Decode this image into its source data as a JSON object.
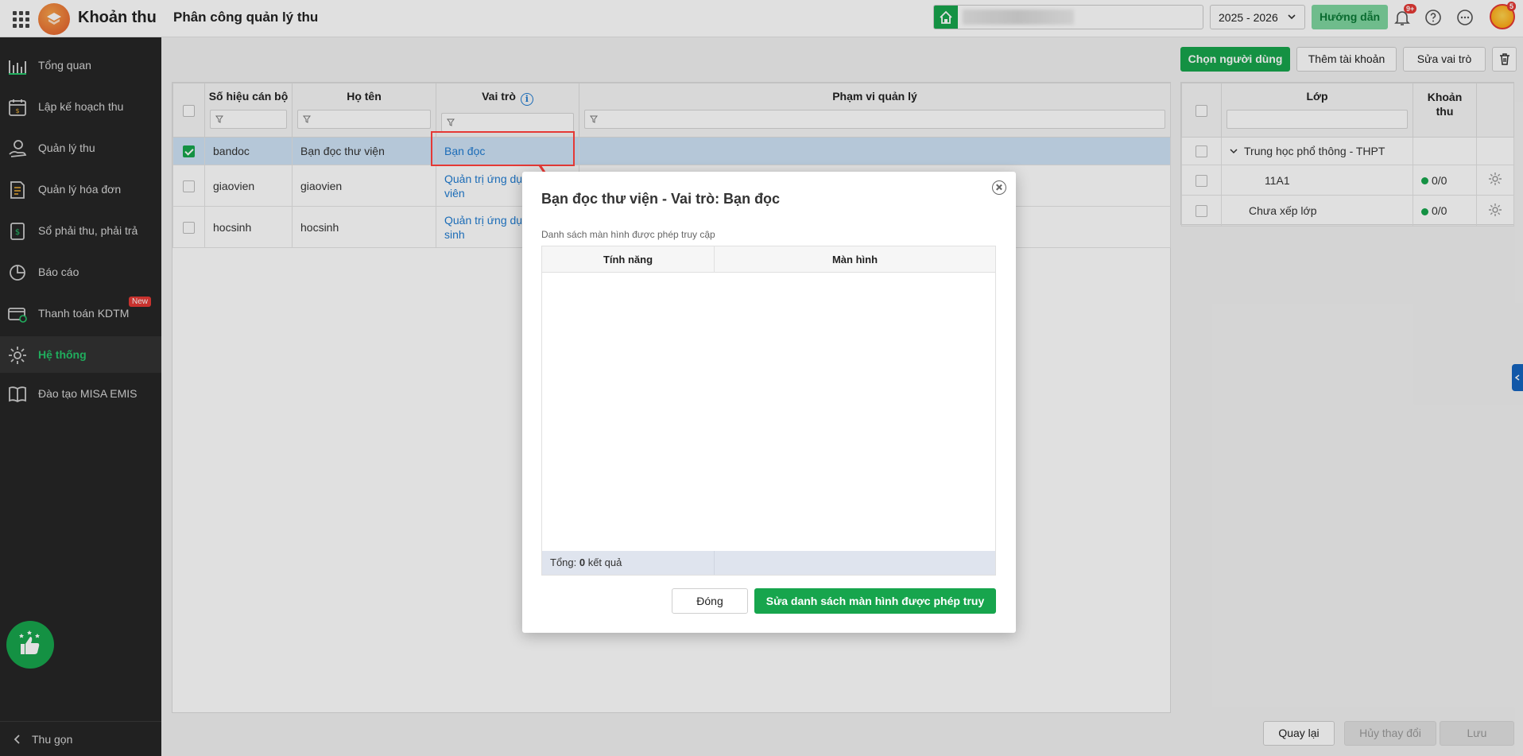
{
  "app": {
    "name": "Khoản thu",
    "page_title": "Phân công quản lý thu",
    "school_year": "2025 - 2026",
    "guide_label": "Hướng dẫn",
    "notification_badge": "9+",
    "avatar_badge": "5",
    "colors": {
      "accent": "#17a54d",
      "sidebar": "#262626",
      "link": "#1f7bd1",
      "highlight": "#e53935"
    }
  },
  "sidebar": {
    "items": [
      {
        "label": "Tổng quan",
        "icon": "bar-chart-icon"
      },
      {
        "label": "Lập kế hoạch thu",
        "icon": "calendar-money-icon"
      },
      {
        "label": "Quản lý thu",
        "icon": "hand-coin-icon"
      },
      {
        "label": "Quản lý hóa đơn",
        "icon": "invoice-icon"
      },
      {
        "label": "Sổ phải thu, phải trả",
        "icon": "ledger-icon"
      },
      {
        "label": "Báo cáo",
        "icon": "pie-chart-icon"
      },
      {
        "label": "Thanh toán KDTM",
        "icon": "card-payment-icon",
        "badge": "New"
      },
      {
        "label": "Hệ thống",
        "icon": "gear-icon",
        "active": true
      },
      {
        "label": "Đào tạo MISA EMIS",
        "icon": "book-icon"
      }
    ],
    "collapse_label": "Thu gọn"
  },
  "toolbar": {
    "choose_user": "Chọn người dùng",
    "add_account": "Thêm tài khoản",
    "edit_role": "Sửa vai trò"
  },
  "users_table": {
    "columns": [
      "Số hiệu cán bộ",
      "Họ tên",
      "Vai trò",
      "Phạm vi quản lý"
    ],
    "rows": [
      {
        "code": "bandoc",
        "name": "Bạn đọc thư viện",
        "role": "Bạn đọc",
        "scope": "",
        "checked": true
      },
      {
        "code": "giaovien",
        "name": "giaovien",
        "role_line1": "Quản trị ứng dụng",
        "role_line2": "viên",
        "scope": ""
      },
      {
        "code": "hocsinh",
        "name": "hocsinh",
        "role_line1": "Quản trị ứng dụng",
        "role_line2": "sinh",
        "scope": ""
      }
    ]
  },
  "class_table": {
    "columns": {
      "class": "Lớp",
      "fee_line1": "Khoản",
      "fee_line2": "thu"
    },
    "rows": [
      {
        "label": "Trung học phổ thông - THPT",
        "fee": ""
      },
      {
        "label": "11A1",
        "fee": "0/0"
      },
      {
        "label": "Chưa xếp lớp",
        "fee": "0/0"
      }
    ]
  },
  "footer": {
    "back": "Quay lại",
    "cancel_changes": "Hủy thay đổi",
    "save": "Lưu"
  },
  "dialog": {
    "title": "Bạn đọc thư viện - Vai trò: Bạn đọc",
    "subtitle": "Danh sách màn hình được phép truy cập",
    "col_feature": "Tính năng",
    "col_screen": "Màn hình",
    "total_prefix": "Tổng: ",
    "total_count": "0",
    "total_suffix": " kết quả",
    "close_label": "Đóng",
    "edit_label": "Sửa danh sách màn hình được phép truy cập"
  }
}
